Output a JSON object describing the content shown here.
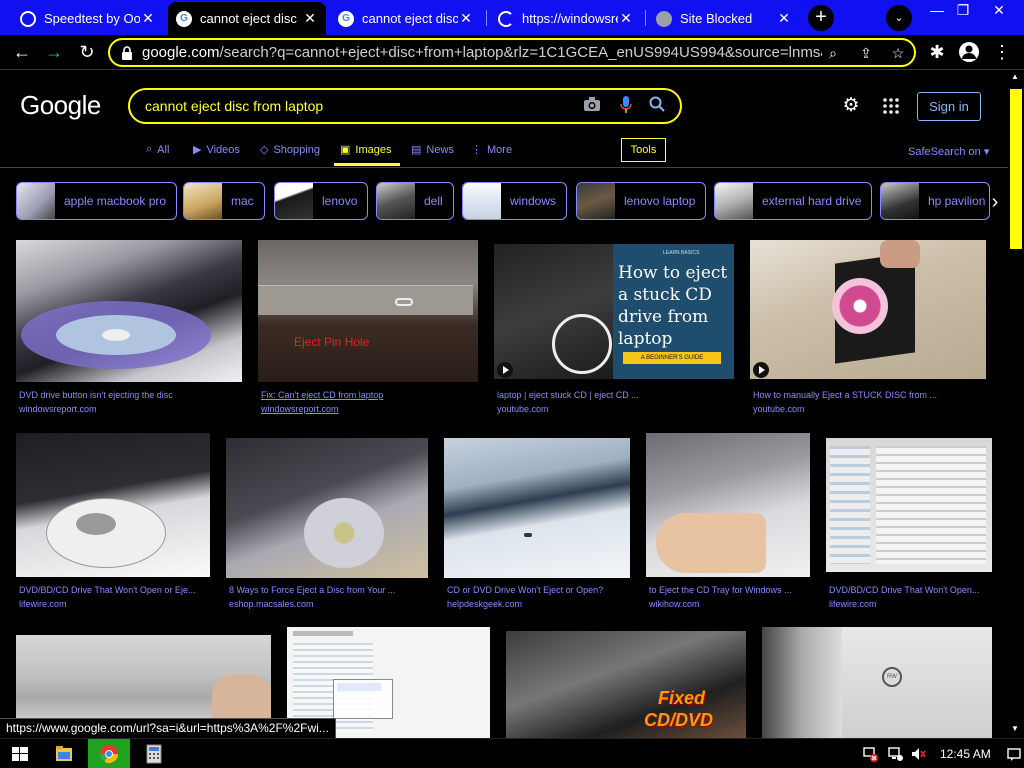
{
  "browser": {
    "tabs": [
      {
        "title": "Speedtest by Ookla",
        "favicon": "speedtest-icon",
        "active": false
      },
      {
        "title": "cannot eject disc",
        "favicon": "google-icon",
        "active": true
      },
      {
        "title": "cannot eject disc",
        "favicon": "google-icon",
        "active": false
      },
      {
        "title": "https://windowsre",
        "favicon": "loading-icon",
        "active": false
      },
      {
        "title": "Site Blocked",
        "favicon": "globe-icon",
        "active": false
      }
    ],
    "new_tab_label": "+",
    "url_domain": "google.com",
    "url_rest": "/search?q=cannot+eject+disc+from+laptop&rlz=1C1GCEA_enUS994US994&source=lnms&tb...",
    "toolbar_icons": [
      "back-icon",
      "forward-icon",
      "reload-icon",
      "lock-icon",
      "search-icon",
      "share-icon",
      "star-icon",
      "extensions-icon",
      "profile-icon",
      "menu-icon"
    ]
  },
  "google": {
    "logo": "Google",
    "query": "cannot eject disc from laptop",
    "signin_label": "Sign in",
    "nav": [
      {
        "label": "All",
        "icon": "search-icon"
      },
      {
        "label": "Videos",
        "icon": "video-icon"
      },
      {
        "label": "Shopping",
        "icon": "tag-icon"
      },
      {
        "label": "Images",
        "icon": "image-icon",
        "active": true
      },
      {
        "label": "News",
        "icon": "news-icon"
      },
      {
        "label": "More",
        "icon": "more-icon"
      }
    ],
    "tools_label": "Tools",
    "safesearch_label": "SafeSearch on"
  },
  "chips": [
    {
      "label": "apple macbook pro"
    },
    {
      "label": "mac"
    },
    {
      "label": "lenovo"
    },
    {
      "label": "dell"
    },
    {
      "label": "windows"
    },
    {
      "label": "lenovo laptop"
    },
    {
      "label": "external hard drive"
    },
    {
      "label": "hp pavilion"
    }
  ],
  "results": [
    {
      "title": "DVD drive button isn't ejecting the disc",
      "source": "windowsreport.com"
    },
    {
      "title": "Fix: Can't eject CD from laptop",
      "source": "windowsreport.com",
      "overlay": "Eject Pin Hole"
    },
    {
      "title": "laptop | eject stuck CD | eject CD ...",
      "source": "youtube.com",
      "overlay_lines": [
        "How to eject",
        "a stuck CD",
        "drive from",
        "laptop"
      ],
      "overlay_small": "LEARN BASICS",
      "overlay_badge": "A BEGINNER'S GUIDE"
    },
    {
      "title": "How to manually Eject a STUCK DISC from ...",
      "source": "youtube.com"
    },
    {
      "title": "DVD/BD/CD Drive That Won't Open or Eje...",
      "source": "lifewire.com"
    },
    {
      "title": "8 Ways to Force Eject a Disc from Your ...",
      "source": "eshop.macsales.com"
    },
    {
      "title": "CD or DVD Drive Won't Eject or Open?",
      "source": "helpdeskgeek.com"
    },
    {
      "title": "to Eject the CD Tray for Windows ...",
      "source": "wikihow.com"
    },
    {
      "title": "DVD/BD/CD Drive That Won't Open...",
      "source": "lifewire.com"
    },
    {
      "title": "",
      "source": ""
    },
    {
      "title": "",
      "source": ""
    },
    {
      "title": "",
      "source": "",
      "overlay_lines": [
        "Fixed",
        "CD/DVD"
      ]
    },
    {
      "title": "",
      "source": "",
      "overlay": "RW"
    }
  ],
  "status_url": "https://www.google.com/url?sa=i&url=https%3A%2F%2Fwi...",
  "taskbar": {
    "clock": "12:45 AM",
    "apps": [
      "windows-start-icon",
      "file-explorer-icon",
      "chrome-icon",
      "calculator-icon"
    ],
    "tray": [
      "network-error-icon",
      "network-icon",
      "volume-muted-icon",
      "notifications-icon"
    ]
  },
  "colors": {
    "tabstrip": "#1010f0",
    "accent_yellow": "#ffff00",
    "link_purple": "#8a8aff",
    "signin_blue": "#8ab4f8"
  }
}
